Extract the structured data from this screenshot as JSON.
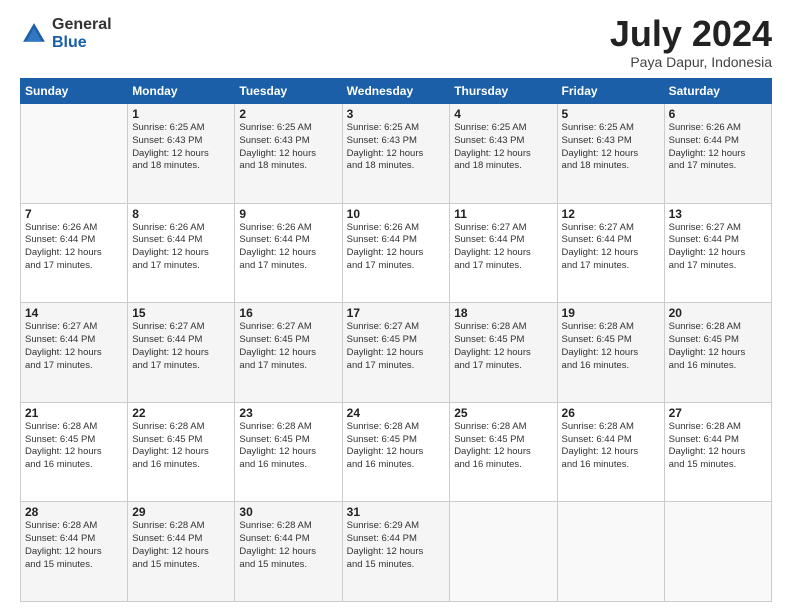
{
  "logo": {
    "general": "General",
    "blue": "Blue"
  },
  "header": {
    "month": "July 2024",
    "location": "Paya Dapur, Indonesia"
  },
  "weekdays": [
    "Sunday",
    "Monday",
    "Tuesday",
    "Wednesday",
    "Thursday",
    "Friday",
    "Saturday"
  ],
  "weeks": [
    [
      {
        "day": "",
        "info": ""
      },
      {
        "day": "1",
        "info": "Sunrise: 6:25 AM\nSunset: 6:43 PM\nDaylight: 12 hours\nand 18 minutes."
      },
      {
        "day": "2",
        "info": "Sunrise: 6:25 AM\nSunset: 6:43 PM\nDaylight: 12 hours\nand 18 minutes."
      },
      {
        "day": "3",
        "info": "Sunrise: 6:25 AM\nSunset: 6:43 PM\nDaylight: 12 hours\nand 18 minutes."
      },
      {
        "day": "4",
        "info": "Sunrise: 6:25 AM\nSunset: 6:43 PM\nDaylight: 12 hours\nand 18 minutes."
      },
      {
        "day": "5",
        "info": "Sunrise: 6:25 AM\nSunset: 6:43 PM\nDaylight: 12 hours\nand 18 minutes."
      },
      {
        "day": "6",
        "info": "Sunrise: 6:26 AM\nSunset: 6:44 PM\nDaylight: 12 hours\nand 17 minutes."
      }
    ],
    [
      {
        "day": "7",
        "info": "Sunrise: 6:26 AM\nSunset: 6:44 PM\nDaylight: 12 hours\nand 17 minutes."
      },
      {
        "day": "8",
        "info": "Sunrise: 6:26 AM\nSunset: 6:44 PM\nDaylight: 12 hours\nand 17 minutes."
      },
      {
        "day": "9",
        "info": "Sunrise: 6:26 AM\nSunset: 6:44 PM\nDaylight: 12 hours\nand 17 minutes."
      },
      {
        "day": "10",
        "info": "Sunrise: 6:26 AM\nSunset: 6:44 PM\nDaylight: 12 hours\nand 17 minutes."
      },
      {
        "day": "11",
        "info": "Sunrise: 6:27 AM\nSunset: 6:44 PM\nDaylight: 12 hours\nand 17 minutes."
      },
      {
        "day": "12",
        "info": "Sunrise: 6:27 AM\nSunset: 6:44 PM\nDaylight: 12 hours\nand 17 minutes."
      },
      {
        "day": "13",
        "info": "Sunrise: 6:27 AM\nSunset: 6:44 PM\nDaylight: 12 hours\nand 17 minutes."
      }
    ],
    [
      {
        "day": "14",
        "info": "Sunrise: 6:27 AM\nSunset: 6:44 PM\nDaylight: 12 hours\nand 17 minutes."
      },
      {
        "day": "15",
        "info": "Sunrise: 6:27 AM\nSunset: 6:44 PM\nDaylight: 12 hours\nand 17 minutes."
      },
      {
        "day": "16",
        "info": "Sunrise: 6:27 AM\nSunset: 6:45 PM\nDaylight: 12 hours\nand 17 minutes."
      },
      {
        "day": "17",
        "info": "Sunrise: 6:27 AM\nSunset: 6:45 PM\nDaylight: 12 hours\nand 17 minutes."
      },
      {
        "day": "18",
        "info": "Sunrise: 6:28 AM\nSunset: 6:45 PM\nDaylight: 12 hours\nand 17 minutes."
      },
      {
        "day": "19",
        "info": "Sunrise: 6:28 AM\nSunset: 6:45 PM\nDaylight: 12 hours\nand 16 minutes."
      },
      {
        "day": "20",
        "info": "Sunrise: 6:28 AM\nSunset: 6:45 PM\nDaylight: 12 hours\nand 16 minutes."
      }
    ],
    [
      {
        "day": "21",
        "info": "Sunrise: 6:28 AM\nSunset: 6:45 PM\nDaylight: 12 hours\nand 16 minutes."
      },
      {
        "day": "22",
        "info": "Sunrise: 6:28 AM\nSunset: 6:45 PM\nDaylight: 12 hours\nand 16 minutes."
      },
      {
        "day": "23",
        "info": "Sunrise: 6:28 AM\nSunset: 6:45 PM\nDaylight: 12 hours\nand 16 minutes."
      },
      {
        "day": "24",
        "info": "Sunrise: 6:28 AM\nSunset: 6:45 PM\nDaylight: 12 hours\nand 16 minutes."
      },
      {
        "day": "25",
        "info": "Sunrise: 6:28 AM\nSunset: 6:45 PM\nDaylight: 12 hours\nand 16 minutes."
      },
      {
        "day": "26",
        "info": "Sunrise: 6:28 AM\nSunset: 6:44 PM\nDaylight: 12 hours\nand 16 minutes."
      },
      {
        "day": "27",
        "info": "Sunrise: 6:28 AM\nSunset: 6:44 PM\nDaylight: 12 hours\nand 15 minutes."
      }
    ],
    [
      {
        "day": "28",
        "info": "Sunrise: 6:28 AM\nSunset: 6:44 PM\nDaylight: 12 hours\nand 15 minutes."
      },
      {
        "day": "29",
        "info": "Sunrise: 6:28 AM\nSunset: 6:44 PM\nDaylight: 12 hours\nand 15 minutes."
      },
      {
        "day": "30",
        "info": "Sunrise: 6:28 AM\nSunset: 6:44 PM\nDaylight: 12 hours\nand 15 minutes."
      },
      {
        "day": "31",
        "info": "Sunrise: 6:29 AM\nSunset: 6:44 PM\nDaylight: 12 hours\nand 15 minutes."
      },
      {
        "day": "",
        "info": ""
      },
      {
        "day": "",
        "info": ""
      },
      {
        "day": "",
        "info": ""
      }
    ]
  ]
}
